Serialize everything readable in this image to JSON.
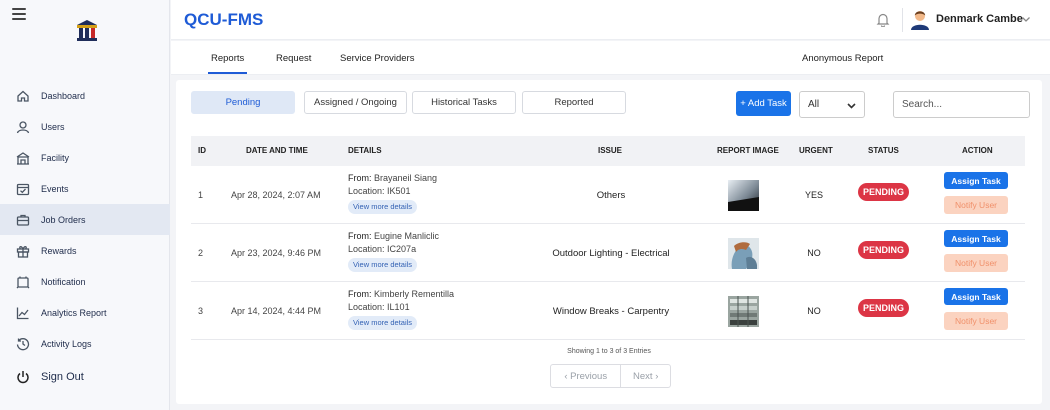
{
  "app": {
    "title": "QCU-FMS"
  },
  "user": {
    "name": "Denmark Cambe"
  },
  "sidebar": {
    "items": [
      {
        "label": "Dashboard",
        "icon": "home-icon"
      },
      {
        "label": "Users",
        "icon": "user-icon"
      },
      {
        "label": "Facility",
        "icon": "building-icon"
      },
      {
        "label": "Events",
        "icon": "calendar-check-icon"
      },
      {
        "label": "Job Orders",
        "icon": "briefcase-icon",
        "active": true
      },
      {
        "label": "Rewards",
        "icon": "gift-icon"
      },
      {
        "label": "Notification",
        "icon": "notification-icon"
      },
      {
        "label": "Analytics Report",
        "icon": "chart-line-icon"
      },
      {
        "label": "Activity Logs",
        "icon": "history-icon"
      }
    ],
    "signout": "Sign Out"
  },
  "tabs": {
    "reports": "Reports",
    "request": "Request",
    "providers": "Service Providers",
    "anonymous": "Anonymous Report"
  },
  "filters": {
    "pending": "Pending",
    "assigned": "Assigned / Ongoing",
    "historical": "Historical Tasks",
    "reported": "Reported"
  },
  "toolbar": {
    "add_task": "+ Add Task",
    "select_value": "All",
    "search_placeholder": "Search..."
  },
  "table": {
    "headers": {
      "id": "ID",
      "date": "DATE AND TIME",
      "details": "DETAILS",
      "issue": "ISSUE",
      "image": "REPORT IMAGE",
      "urgent": "URGENT",
      "status": "STATUS",
      "action": "ACTION"
    },
    "from_label": "From:",
    "location_label": "Location:",
    "view_more": "View more details",
    "assign_label": "Assign Task",
    "notify_label": "Notify User",
    "rows": [
      {
        "id": "1",
        "date": "Apr 28, 2024, 2:07 AM",
        "from": "Brayaneil Siang",
        "location": "IK501",
        "issue": "Others",
        "urgent": "YES",
        "status": "PENDING"
      },
      {
        "id": "2",
        "date": "Apr 23, 2024, 9:46 PM",
        "from": "Eugine Manliclic",
        "location": "IC207a",
        "issue": "Outdoor Lighting - Electrical",
        "urgent": "NO",
        "status": "PENDING"
      },
      {
        "id": "3",
        "date": "Apr 14, 2024, 4:44 PM",
        "from": "Kimberly Rementilla",
        "location": "IL101",
        "issue": "Window Breaks - Carpentry",
        "urgent": "NO",
        "status": "PENDING"
      }
    ]
  },
  "pagination": {
    "showing": "Showing 1 to 3 of 3 Entries",
    "previous": "‹ Previous",
    "next": "Next ›"
  },
  "colors": {
    "primary": "#1a73e8",
    "brand_title": "#1e5bd6",
    "status_pending": "#dc3545",
    "notify_bg": "#fbd3c0"
  }
}
